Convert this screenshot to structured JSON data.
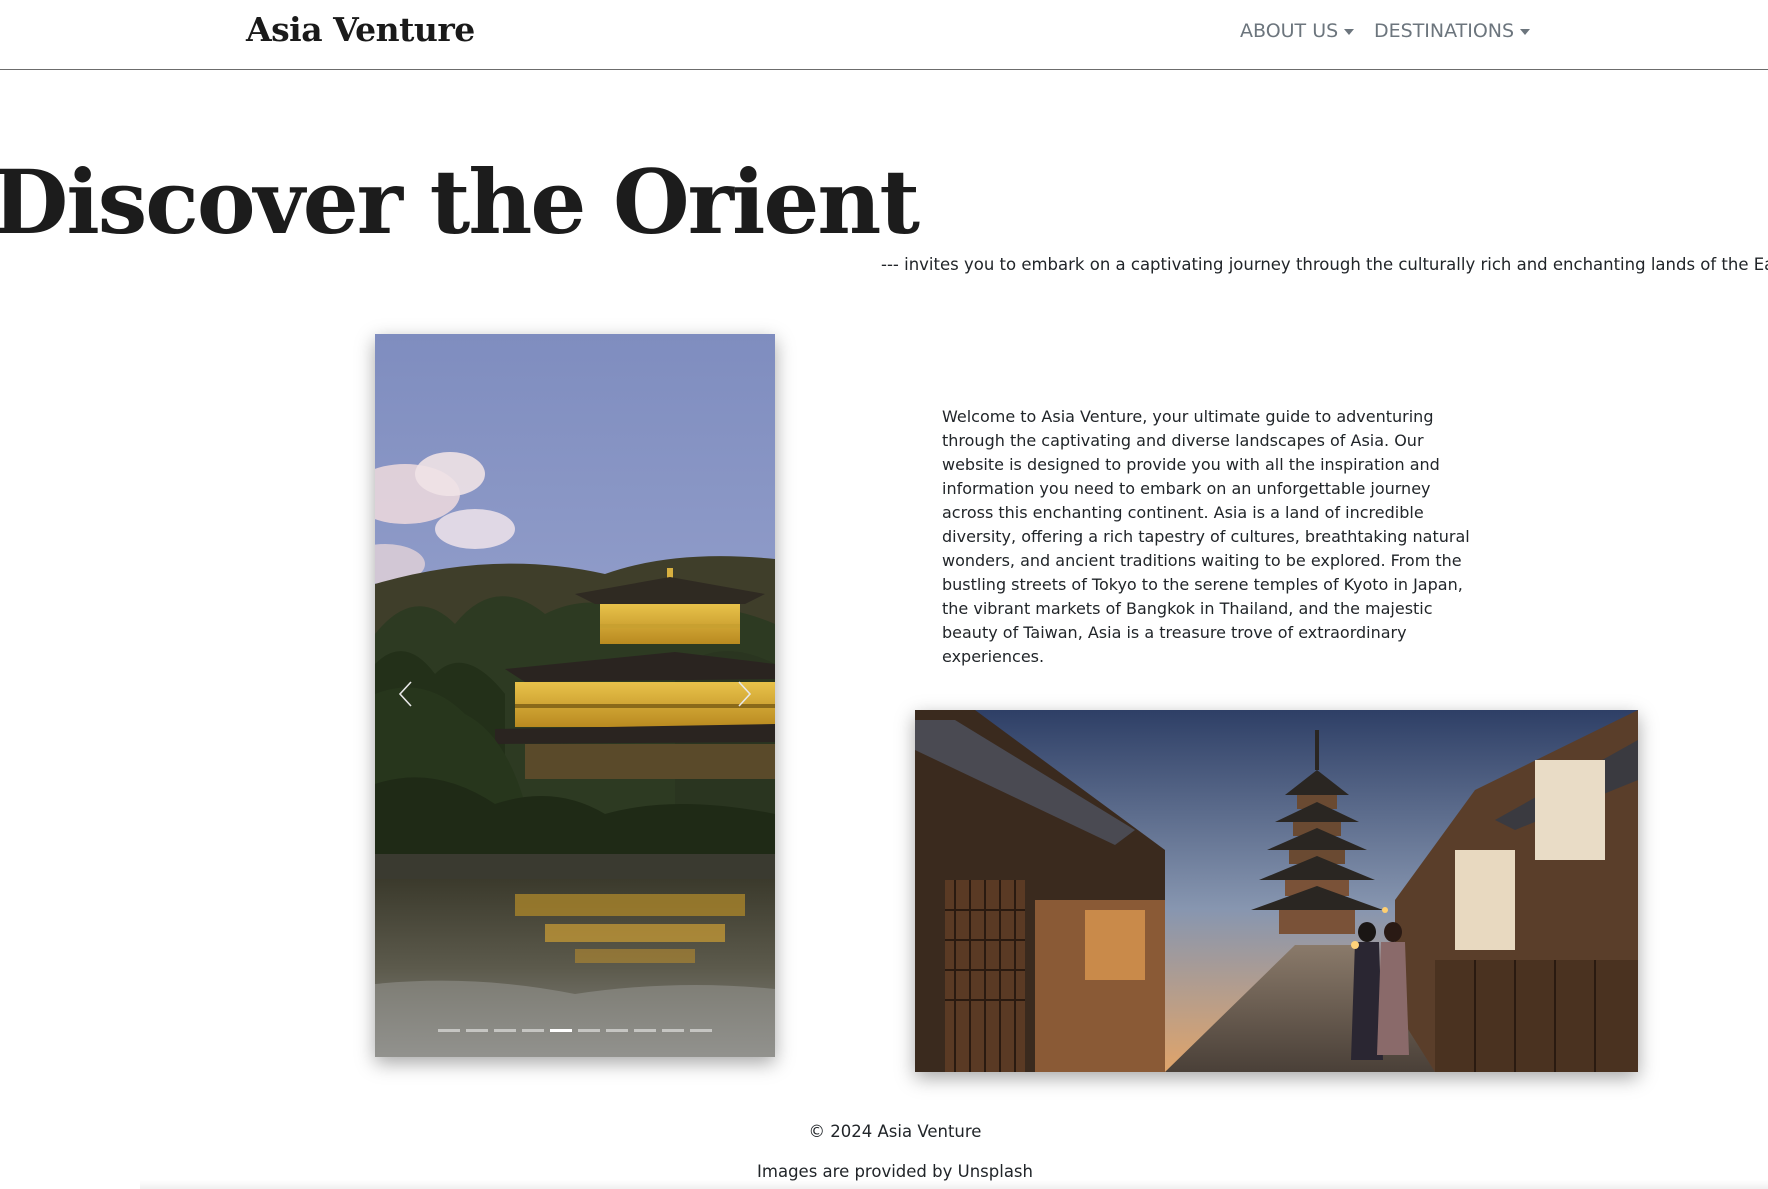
{
  "navbar": {
    "brand": "Asia Venture",
    "items": [
      {
        "label": "ABOUT US",
        "icon": "caret-down-icon"
      },
      {
        "label": "DESTINATIONS",
        "icon": "caret-down-icon"
      }
    ]
  },
  "hero": {
    "title": "Discover the Orient",
    "subtitle": "--- invites you to embark on a captivating journey through the culturally rich and enchanting lands of the East"
  },
  "carousel": {
    "image": "golden-pavilion-temple-photo",
    "prev_icon": "chevron-left-icon",
    "next_icon": "chevron-right-icon",
    "slide_count": 10,
    "active_index": 4
  },
  "main": {
    "description": "Welcome to Asia Venture, your ultimate guide to adventuring through the captivating and diverse landscapes of Asia. Our website is designed to provide you with all the inspiration and information you need to embark on an unforgettable journey across this enchanting continent. Asia is a land of incredible diversity, offering a rich tapestry of cultures, breathtaking natural wonders, and ancient traditions waiting to be explored. From the bustling streets of Tokyo to the serene temples of Kyoto in Japan, the vibrant markets of Bangkok in Thailand, and the majestic beauty of Taiwan, Asia is a treasure trove of extraordinary experiences.",
    "street_image": "kyoto-street-pagoda-photo"
  },
  "footer": {
    "copyright": "© 2024 Asia Venture",
    "credit": "Images are provided by Unsplash"
  }
}
